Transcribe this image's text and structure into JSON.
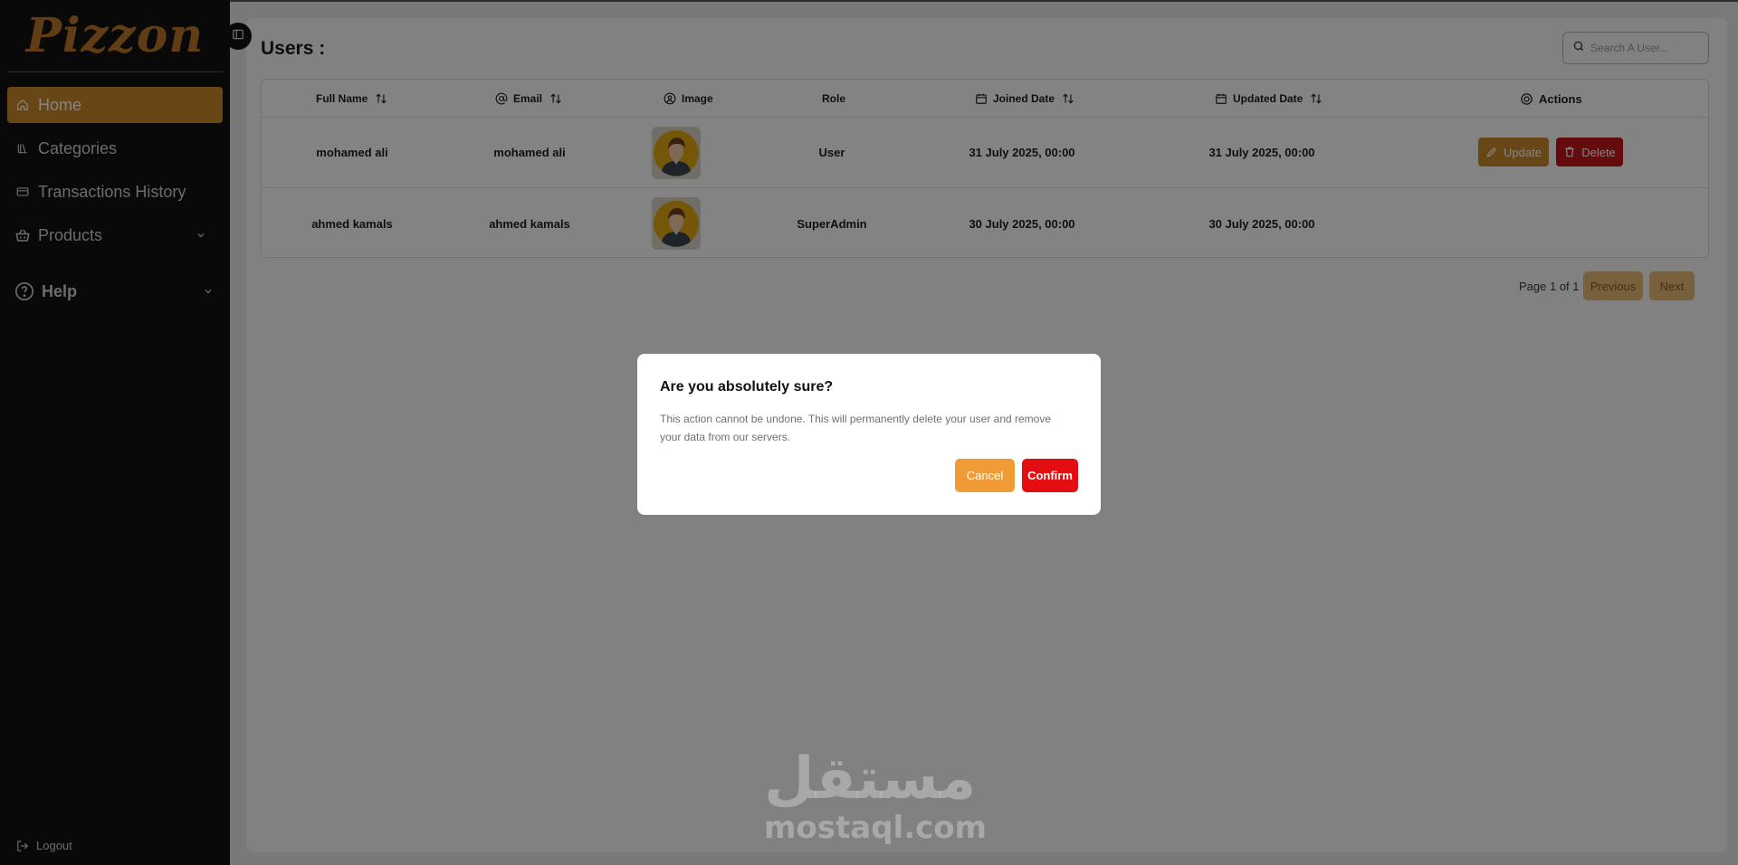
{
  "brand": {
    "logo_text": "Pizzon",
    "accent": "#c8862b"
  },
  "sidebar": {
    "items": [
      {
        "label": "Home",
        "icon": "home-icon",
        "active": true
      },
      {
        "label": "Categories",
        "icon": "books-icon"
      },
      {
        "label": "Transactions History",
        "icon": "card-icon"
      },
      {
        "label": "Products",
        "icon": "basket-icon",
        "expandable": true
      },
      {
        "label": "Help",
        "icon": "help-circle-icon",
        "expandable": true
      }
    ],
    "logout_label": "Logout"
  },
  "page": {
    "title": "Users :"
  },
  "search": {
    "placeholder": "Search A User..."
  },
  "table": {
    "headers": {
      "full_name": "Full Name",
      "email": "Email",
      "image": "Image",
      "role": "Role",
      "joined": "Joined Date",
      "updated": "Updated Date",
      "actions": "Actions"
    },
    "rows": [
      {
        "full_name": "mohamed ali",
        "email": "mohamed ali",
        "role": "User",
        "joined": "31 July 2025, 00:00",
        "updated": "31 July 2025, 00:00",
        "update_label": "Update",
        "delete_label": "Delete"
      },
      {
        "full_name": "ahmed kamals",
        "email": "ahmed kamals",
        "role": "SuperAdmin",
        "joined": "30 July 2025, 00:00",
        "updated": "30 July 2025, 00:00"
      }
    ]
  },
  "pagination": {
    "text": "Page 1 of 1",
    "previous": "Previous",
    "next": "Next"
  },
  "dialog": {
    "title": "Are you absolutely sure?",
    "description": "This action cannot be undone. This will permanently delete your user and remove your data from our servers.",
    "cancel": "Cancel",
    "confirm": "Confirm"
  },
  "watermark": {
    "arabic": "مستقل",
    "latin": "mostaql.com"
  }
}
